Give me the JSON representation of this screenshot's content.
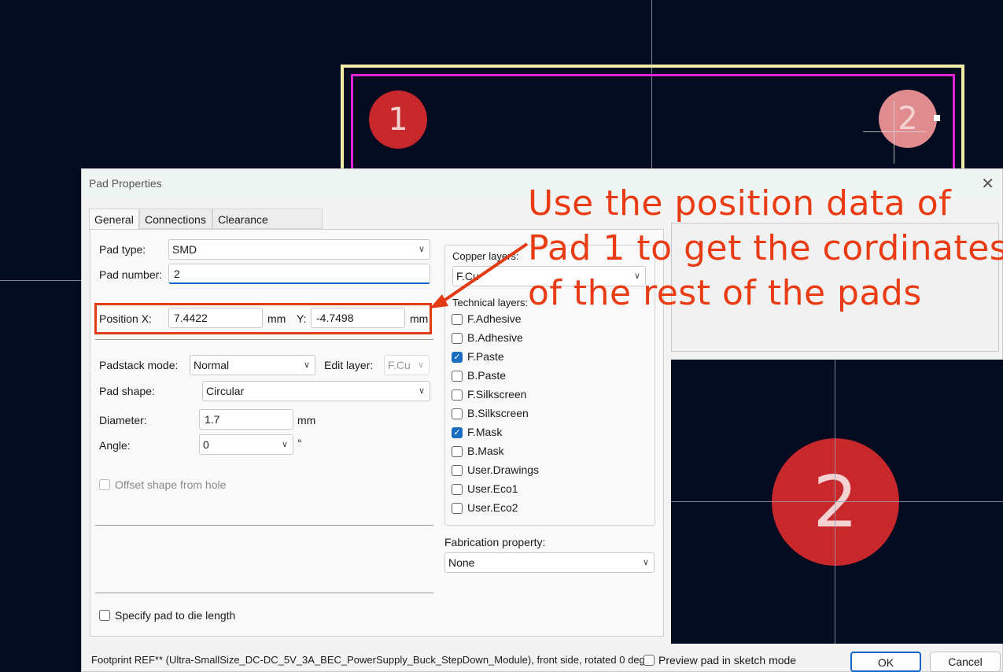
{
  "pads": {
    "pad1_label": "1",
    "pad2_label": "2",
    "preview_pad_label": "2"
  },
  "dialog": {
    "title": "Pad Properties",
    "tabs": [
      "General",
      "Connections",
      "Clearance Overrides"
    ],
    "pad_type": {
      "label": "Pad type:",
      "value": "SMD"
    },
    "pad_number": {
      "label": "Pad number:",
      "value": "2"
    },
    "position": {
      "x_label": "Position X:",
      "x_value": "7.4422",
      "x_unit": "mm",
      "y_label": "Y:",
      "y_value": "-4.7498",
      "y_unit": "mm"
    },
    "padstack_mode": {
      "label": "Padstack mode:",
      "value": "Normal"
    },
    "edit_layer": {
      "label": "Edit layer:",
      "value": "F.Cu"
    },
    "pad_shape": {
      "label": "Pad shape:",
      "value": "Circular"
    },
    "diameter": {
      "label": "Diameter:",
      "value": "1.7",
      "unit": "mm"
    },
    "angle": {
      "label": "Angle:",
      "value": "0",
      "unit": "°"
    },
    "offset_shape": "Offset shape from hole",
    "die_length": "Specify pad to die length",
    "copper_layers": {
      "label": "Copper layers:",
      "value": "F.Cu"
    },
    "technical_layers": {
      "label": "Technical layers:",
      "items": [
        {
          "name": "F.Adhesive",
          "checked": false
        },
        {
          "name": "B.Adhesive",
          "checked": false
        },
        {
          "name": "F.Paste",
          "checked": true
        },
        {
          "name": "B.Paste",
          "checked": false
        },
        {
          "name": "F.Silkscreen",
          "checked": false
        },
        {
          "name": "B.Silkscreen",
          "checked": false
        },
        {
          "name": "F.Mask",
          "checked": true
        },
        {
          "name": "B.Mask",
          "checked": false
        },
        {
          "name": "User.Drawings",
          "checked": false
        },
        {
          "name": "User.Eco1",
          "checked": false
        },
        {
          "name": "User.Eco2",
          "checked": false
        }
      ]
    },
    "fabrication": {
      "label": "Fabrication property:",
      "value": "None"
    },
    "footer_text": "Footprint REF** (Ultra-SmallSize_DC-DC_5V_3A_BEC_PowerSupply_Buck_StepDown_Module), front side, rotated 0 deg",
    "preview_sketch": "Preview pad in sketch mode",
    "ok": "OK",
    "cancel": "Cancel"
  },
  "annotation": {
    "lines": [
      "Use the position data of",
      "Pad 1 to get the cordinates",
      "of the rest of the pads"
    ],
    "color": "#e93c14"
  }
}
